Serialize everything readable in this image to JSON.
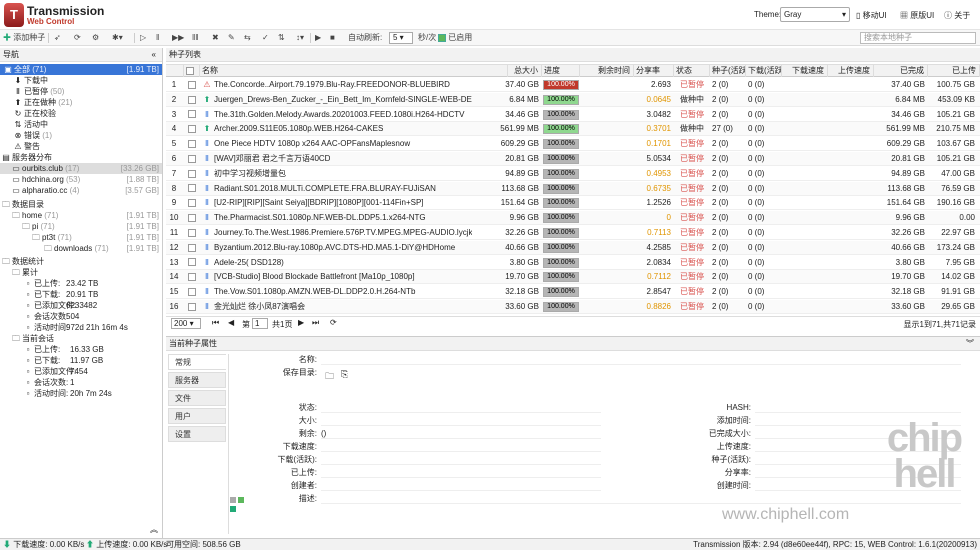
{
  "app": {
    "title": "Transmission",
    "subtitle": "Web Control",
    "logo": "T"
  },
  "header": {
    "theme_label": "Theme:",
    "theme_value": "Gray",
    "mobile_ui": "移动UI",
    "original_ui": "原版UI",
    "about": "关于"
  },
  "toolbar": {
    "add": "添加种子",
    "auto_refresh_label": "自动刷新:",
    "auto_refresh_value": "5",
    "unit": "秒/次",
    "enabled_label": "已启用",
    "search_placeholder": "搜索本地种子"
  },
  "sidebar": {
    "title": "导航",
    "items": [
      {
        "label": "全部",
        "count": "(71)",
        "size": "[1.91 TB]"
      },
      {
        "label": "下载中",
        "count": "",
        "size": ""
      },
      {
        "label": "已暂停",
        "count": "(50)",
        "size": ""
      },
      {
        "label": "正在做种",
        "count": "(21)",
        "size": ""
      },
      {
        "label": "正在校验",
        "count": "",
        "size": ""
      },
      {
        "label": "活动中",
        "count": "",
        "size": ""
      },
      {
        "label": "错误",
        "count": "(1)",
        "size": ""
      },
      {
        "label": "警告",
        "count": "",
        "size": ""
      },
      {
        "label": "服务器分布",
        "count": "",
        "size": ""
      },
      {
        "label": "ourbits.club",
        "count": "(17)",
        "size": "[33.26 GB]"
      },
      {
        "label": "hdchina.org",
        "count": "(53)",
        "size": "[1.88 TB]"
      },
      {
        "label": "alpharatio.cc",
        "count": "(4)",
        "size": "[3.57 GB]"
      },
      {
        "label": "数据目录",
        "count": "",
        "size": ""
      },
      {
        "label": "home",
        "count": "(71)",
        "size": "[1.91 TB]"
      },
      {
        "label": "pi",
        "count": "(71)",
        "size": "[1.91 TB]"
      },
      {
        "label": "pt3t",
        "count": "(71)",
        "size": "[1.91 TB]"
      },
      {
        "label": "downloads",
        "count": "(71)",
        "size": "[1.91 TB]"
      },
      {
        "label": "数据统计",
        "count": "",
        "size": ""
      },
      {
        "label": "累计",
        "count": "",
        "size": ""
      },
      {
        "label": "已上传:",
        "count": "23.42 TB",
        "size": ""
      },
      {
        "label": "已下载:",
        "count": "20.91 TB",
        "size": ""
      },
      {
        "label": "已添加文件:",
        "count": "6233482",
        "size": ""
      },
      {
        "label": "会话次数:",
        "count": "504",
        "size": ""
      },
      {
        "label": "活动时间:",
        "count": "972d 21h 16m 4s",
        "size": ""
      },
      {
        "label": "当前会话",
        "count": "",
        "size": ""
      },
      {
        "label": "已上传:",
        "count": "16.33 GB",
        "size": ""
      },
      {
        "label": "已下载:",
        "count": "11.97 GB",
        "size": ""
      },
      {
        "label": "已添加文件:",
        "count": "7454",
        "size": ""
      },
      {
        "label": "会话次数:",
        "count": "1",
        "size": ""
      },
      {
        "label": "活动时间:",
        "count": "20h 7m 24s",
        "size": ""
      }
    ]
  },
  "list": {
    "title": "种子列表",
    "columns": [
      "名称",
      "总大小",
      "进度",
      "剩余时间",
      "分享率",
      "状态",
      "种子(活跃)",
      "下载(活跃)",
      "下载速度",
      "上传速度",
      "已完成",
      "已上传"
    ],
    "rows": [
      {
        "n": "1",
        "name": "The.Concorde..Airport.79.1979.Blu-Ray.FREEDONOR-BLUEBIRD",
        "size": "37.40 GB",
        "prog": "100.00%",
        "pc": "r",
        "ratio": "2.693",
        "st": "已暂停",
        "seed": "2 (0)",
        "dl": "0 (0)",
        "done": "37.40 GB",
        "up": "100.75 GB",
        "icon": "warn"
      },
      {
        "n": "2",
        "name": "Juergen_Drews-Ben_Zucker_-_Ein_Bett_Im_Kornfeld-SINGLE-WEB-DE-2020-iDLE",
        "size": "6.84 MB",
        "prog": "100.00%",
        "pc": "g",
        "ratio": "0.0645",
        "st": "做种中",
        "seed": "2 (0)",
        "dl": "0 (0)",
        "done": "6.84 MB",
        "up": "453.09 KB",
        "icon": "up"
      },
      {
        "n": "3",
        "name": "The.31th.Golden.Melody.Awards.20201003.FEED.1080i.H264-HDCTV",
        "size": "34.46 GB",
        "prog": "100.00%",
        "pc": "gr",
        "ratio": "3.0482",
        "st": "已暂停",
        "seed": "2 (0)",
        "dl": "0 (0)",
        "done": "34.46 GB",
        "up": "105.21 GB",
        "icon": "pause"
      },
      {
        "n": "4",
        "name": "Archer.2009.S11E05.1080p.WEB.H264-CAKES",
        "size": "561.99 MB",
        "prog": "100.00%",
        "pc": "g",
        "ratio": "0.3701",
        "st": "做种中",
        "seed": "27 (0)",
        "dl": "0 (0)",
        "done": "561.99 MB",
        "up": "210.75 MB",
        "icon": "up"
      },
      {
        "n": "5",
        "name": "One Piece HDTV 1080p x264 AAC-OPFansMaplesnow",
        "size": "609.29 GB",
        "prog": "100.00%",
        "pc": "gr",
        "ratio": "0.1701",
        "st": "已暂停",
        "seed": "2 (0)",
        "dl": "0 (0)",
        "done": "609.29 GB",
        "up": "103.67 GB",
        "icon": "pause"
      },
      {
        "n": "6",
        "name": "[WAV]邓丽君 君之千言万语40CD",
        "size": "20.81 GB",
        "prog": "100.00%",
        "pc": "gr",
        "ratio": "5.0534",
        "st": "已暂停",
        "seed": "2 (0)",
        "dl": "0 (0)",
        "done": "20.81 GB",
        "up": "105.21 GB",
        "icon": "pause"
      },
      {
        "n": "7",
        "name": "初中学习视频增量包",
        "size": "94.89 GB",
        "prog": "100.00%",
        "pc": "gr",
        "ratio": "0.4953",
        "st": "已暂停",
        "seed": "2 (0)",
        "dl": "0 (0)",
        "done": "94.89 GB",
        "up": "47.00 GB",
        "icon": "pause"
      },
      {
        "n": "8",
        "name": "Radiant.S01.2018.MULTi.COMPLETE.FRA.BLURAY-FUJiSAN",
        "size": "113.68 GB",
        "prog": "100.00%",
        "pc": "gr",
        "ratio": "0.6735",
        "st": "已暂停",
        "seed": "2 (0)",
        "dl": "0 (0)",
        "done": "113.68 GB",
        "up": "76.59 GB",
        "icon": "pause"
      },
      {
        "n": "9",
        "name": "[U2-RIP][RIP][Saint Seiya][BDRIP][1080P][001-114Fin+SP]",
        "size": "151.64 GB",
        "prog": "100.00%",
        "pc": "gr",
        "ratio": "1.2526",
        "st": "已暂停",
        "seed": "2 (0)",
        "dl": "0 (0)",
        "done": "151.64 GB",
        "up": "190.16 GB",
        "icon": "pause"
      },
      {
        "n": "10",
        "name": "The.Pharmacist.S01.1080p.NF.WEB-DL.DDP5.1.x264-NTG",
        "size": "9.96 GB",
        "prog": "100.00%",
        "pc": "gr",
        "ratio": "0",
        "st": "已暂停",
        "seed": "2 (0)",
        "dl": "0 (0)",
        "done": "9.96 GB",
        "up": "0.00",
        "icon": "pause"
      },
      {
        "n": "11",
        "name": "Journey.To.The.West.1986.Premiere.576P.TV.MPEG.MPEG-AUDIO.lycjkcz",
        "size": "32.26 GB",
        "prog": "100.00%",
        "pc": "gr",
        "ratio": "0.7113",
        "st": "已暂停",
        "seed": "2 (0)",
        "dl": "0 (0)",
        "done": "32.26 GB",
        "up": "22.97 GB",
        "icon": "pause"
      },
      {
        "n": "12",
        "name": "Byzantium.2012.Blu-ray.1080p.AVC.DTS-HD.MA5.1-DiY@HDHome",
        "size": "40.66 GB",
        "prog": "100.00%",
        "pc": "gr",
        "ratio": "4.2585",
        "st": "已暂停",
        "seed": "2 (0)",
        "dl": "0 (0)",
        "done": "40.66 GB",
        "up": "173.24 GB",
        "icon": "pause"
      },
      {
        "n": "13",
        "name": "Adele-25( DSD128)",
        "size": "3.80 GB",
        "prog": "100.00%",
        "pc": "gr",
        "ratio": "2.0834",
        "st": "已暂停",
        "seed": "2 (0)",
        "dl": "0 (0)",
        "done": "3.80 GB",
        "up": "7.95 GB",
        "icon": "pause"
      },
      {
        "n": "14",
        "name": "[VCB-Studio] Blood Blockade Battlefront [Ma10p_1080p]",
        "size": "19.70 GB",
        "prog": "100.00%",
        "pc": "gr",
        "ratio": "0.7112",
        "st": "已暂停",
        "seed": "2 (0)",
        "dl": "0 (0)",
        "done": "19.70 GB",
        "up": "14.02 GB",
        "icon": "pause"
      },
      {
        "n": "15",
        "name": "The.Vow.S01.1080p.AMZN.WEB-DL.DDP2.0.H.264-NTb",
        "size": "32.18 GB",
        "prog": "100.00%",
        "pc": "gr",
        "ratio": "2.8547",
        "st": "已暂停",
        "seed": "2 (0)",
        "dl": "0 (0)",
        "done": "32.18 GB",
        "up": "91.91 GB",
        "icon": "pause"
      },
      {
        "n": "16",
        "name": "金光灿烂 徐小凤87演唱会",
        "size": "33.60 GB",
        "prog": "100.00%",
        "pc": "gr",
        "ratio": "0.8826",
        "st": "已暂停",
        "seed": "2 (0)",
        "dl": "0 (0)",
        "done": "33.60 GB",
        "up": "29.65 GB",
        "icon": "pause"
      }
    ]
  },
  "pager": {
    "page_size": "200",
    "page_prefix": "第",
    "page_value": "1",
    "page_suffix": "共1页",
    "summary": "显示1到71,共71记录"
  },
  "props": {
    "title": "当前种子属性",
    "tabs": [
      "常规",
      "服务器",
      "文件",
      "用户",
      "设置"
    ],
    "left_labels": [
      "名称:",
      "保存目录:",
      "状态:",
      "大小:",
      "剩余:",
      "下载速度:",
      "下载(活跃):",
      "已上传:",
      "创建者:",
      "描述:"
    ],
    "remaining_value": "()",
    "right_labels": [
      "HASH:",
      "添加时间:",
      "已完成大小:",
      "上传速度:",
      "种子(活跃):",
      "分享率:",
      "创建时间:"
    ]
  },
  "footer": {
    "dl_label": "下载速度:",
    "dl_value": "0.00 KB/s",
    "ul_label": "上传速度:",
    "ul_value": "0.00 KB/s",
    "space_label": "可用空间:",
    "space_value": "508.56 GB",
    "version": "Transmission 版本: 2.94 (d8e60ee44f), RPC: 15, WEB Control: 1.6.1(20200913)"
  },
  "watermark": {
    "big": "chip hell",
    "url": "www.chiphell.com"
  }
}
